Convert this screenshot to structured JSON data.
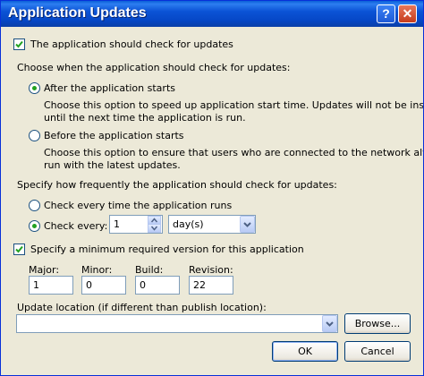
{
  "window": {
    "title": "Application Updates"
  },
  "check_updates": {
    "label": "The application should check for updates",
    "checked": true
  },
  "when": {
    "heading": "Choose when the application should check for updates:",
    "after_label": "After the application starts",
    "after_desc_1": "Choose this option to speed up application start time. Updates will not be installed",
    "after_desc_2": "until the next time the application is run.",
    "before_label": "Before the application starts",
    "before_desc_1": "Choose this option to ensure that users who are connected to the network always",
    "before_desc_2": "run with the latest updates.",
    "selected": "after"
  },
  "frequency": {
    "heading": "Specify how frequently the application should check for updates:",
    "every_run_label": "Check every time the application runs",
    "every_label": "Check every:",
    "every_value": "1",
    "unit_value": "day(s)",
    "selected": "every"
  },
  "min_version": {
    "label": "Specify a minimum required version for this application",
    "checked": true,
    "major_label": "Major:",
    "minor_label": "Minor:",
    "build_label": "Build:",
    "revision_label": "Revision:",
    "major": "1",
    "minor": "0",
    "build": "0",
    "revision": "22"
  },
  "location": {
    "label": "Update location (if different than publish location):",
    "value": ""
  },
  "buttons": {
    "browse": "Browse...",
    "ok": "OK",
    "cancel": "Cancel"
  },
  "colors": {
    "titlebar": "#0a53d6",
    "dialog_bg": "#ece9d8",
    "radio_dot": "#21a121",
    "check": "#21a121"
  }
}
